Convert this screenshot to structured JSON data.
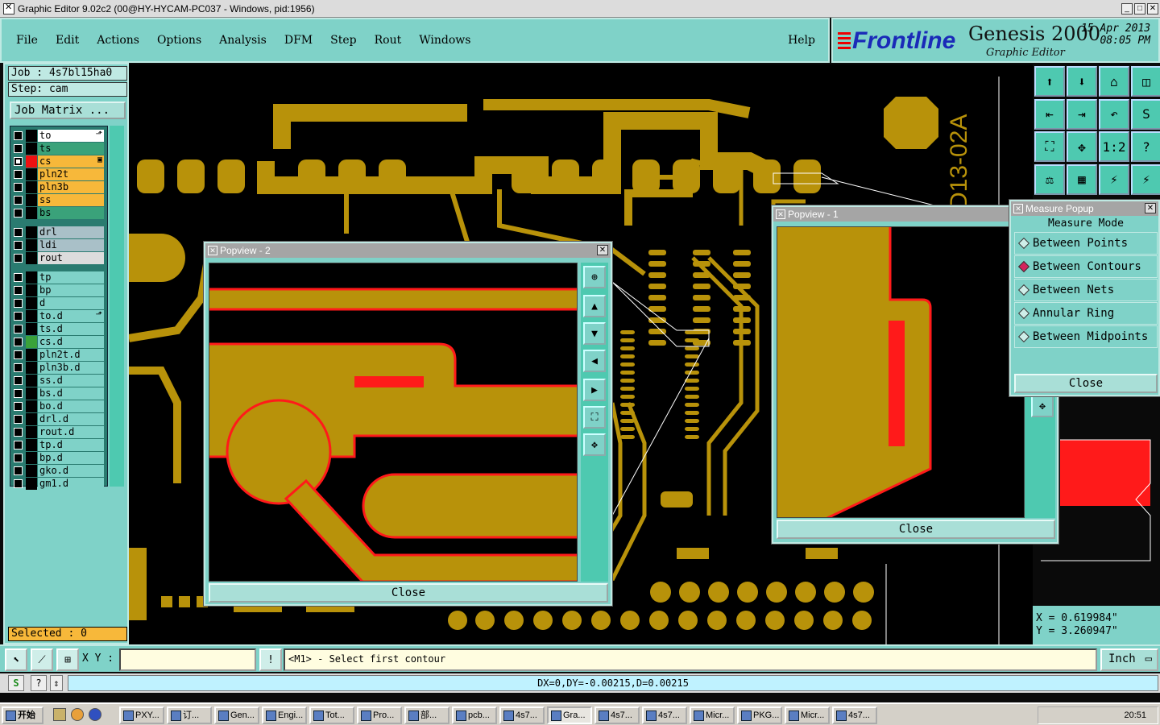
{
  "window": {
    "title": "Graphic Editor 9.02c2 (00@HY-HYCAM-PC037 - Windows, pid:1956)"
  },
  "menu": [
    "File",
    "Edit",
    "Actions",
    "Options",
    "Analysis",
    "DFM",
    "Step",
    "Rout",
    "Windows"
  ],
  "help": "Help",
  "brand": {
    "logo": "Frontline",
    "product": "Genesis 2000",
    "subtitle": "Graphic Editor",
    "date": "15 Apr 2013",
    "time": "08:05 PM"
  },
  "job": {
    "job": "Job  : 4s7bl15ha0",
    "step": "Step: cam",
    "matrix_button": "Job Matrix ..."
  },
  "layers": [
    {
      "name": "to",
      "bg": "#ffffff",
      "swatch": "#000000",
      "mark": "⬏",
      "checked": false
    },
    {
      "name": "ts",
      "bg": "#3aa27a",
      "swatch": "#000000",
      "mark": "",
      "checked": false
    },
    {
      "name": "cs",
      "bg": "#f7b83a",
      "swatch": "#ee1111",
      "mark": "▣",
      "checked": true
    },
    {
      "name": "pln2t",
      "bg": "#f7b83a",
      "swatch": "#000000",
      "mark": "",
      "checked": false
    },
    {
      "name": "pln3b",
      "bg": "#f7b83a",
      "swatch": "#000000",
      "mark": "",
      "checked": false
    },
    {
      "name": "ss",
      "bg": "#f7b83a",
      "swatch": "#000000",
      "mark": "",
      "checked": false
    },
    {
      "name": "bs",
      "bg": "#3aa27a",
      "swatch": "#000000",
      "mark": "",
      "checked": false
    },
    {
      "name": "drl",
      "bg": "#a9c0c8",
      "swatch": "#000000",
      "mark": "",
      "checked": false,
      "gap": true
    },
    {
      "name": "ldi",
      "bg": "#a9c0c8",
      "swatch": "#000000",
      "mark": "",
      "checked": false
    },
    {
      "name": "rout",
      "bg": "#dcdcdc",
      "swatch": "#000000",
      "mark": "",
      "checked": false
    },
    {
      "name": "tp",
      "bg": "#7fd2c8",
      "swatch": "#000000",
      "mark": "",
      "checked": false,
      "gap": true
    },
    {
      "name": "bp",
      "bg": "#7fd2c8",
      "swatch": "#000000",
      "mark": "",
      "checked": false
    },
    {
      "name": "d",
      "bg": "#7fd2c8",
      "swatch": "#000000",
      "mark": "",
      "checked": false
    },
    {
      "name": "to.d",
      "bg": "#7fd2c8",
      "swatch": "#000000",
      "mark": "⬏",
      "checked": false
    },
    {
      "name": "ts.d",
      "bg": "#7fd2c8",
      "swatch": "#000000",
      "mark": "",
      "checked": false
    },
    {
      "name": "cs.d",
      "bg": "#7fd2c8",
      "swatch": "#3aa23a",
      "mark": "",
      "checked": false
    },
    {
      "name": "pln2t.d",
      "bg": "#7fd2c8",
      "swatch": "#000000",
      "mark": "",
      "checked": false
    },
    {
      "name": "pln3b.d",
      "bg": "#7fd2c8",
      "swatch": "#000000",
      "mark": "",
      "checked": false
    },
    {
      "name": "ss.d",
      "bg": "#7fd2c8",
      "swatch": "#000000",
      "mark": "",
      "checked": false
    },
    {
      "name": "bs.d",
      "bg": "#7fd2c8",
      "swatch": "#000000",
      "mark": "",
      "checked": false
    },
    {
      "name": "bo.d",
      "bg": "#7fd2c8",
      "swatch": "#000000",
      "mark": "",
      "checked": false
    },
    {
      "name": "drl.d",
      "bg": "#7fd2c8",
      "swatch": "#000000",
      "mark": "",
      "checked": false
    },
    {
      "name": "rout.d",
      "bg": "#7fd2c8",
      "swatch": "#000000",
      "mark": "",
      "checked": false
    },
    {
      "name": "tp.d",
      "bg": "#7fd2c8",
      "swatch": "#000000",
      "mark": "",
      "checked": false
    },
    {
      "name": "bp.d",
      "bg": "#7fd2c8",
      "swatch": "#000000",
      "mark": "",
      "checked": false
    },
    {
      "name": "gko.d",
      "bg": "#7fd2c8",
      "swatch": "#000000",
      "mark": "",
      "checked": false
    },
    {
      "name": "gm1.d",
      "bg": "#7fd2c8",
      "swatch": "#000000",
      "mark": "",
      "checked": false
    }
  ],
  "selected": "Selected : 0",
  "board_label": "D13-02A",
  "colors": {
    "copper": "#b8920a",
    "highlight": "#ff1a1a",
    "panel": "#7fd2c8"
  },
  "popview2": {
    "title": "Popview - 2",
    "close": "Close"
  },
  "popview1": {
    "title": "Popview - 1",
    "close": "Close"
  },
  "measure": {
    "title": "Measure Popup",
    "mode_label": "Measure Mode",
    "options": [
      {
        "label": "Between Points",
        "selected": false
      },
      {
        "label": "Between Contours",
        "selected": true
      },
      {
        "label": "Between Nets",
        "selected": false
      },
      {
        "label": "Annular Ring",
        "selected": false
      },
      {
        "label": "Between Midpoints",
        "selected": false
      }
    ],
    "close": "Close"
  },
  "coords": {
    "x": "X = 0.619984\"",
    "y": "Y = 3.260947\""
  },
  "bottom": {
    "xy_label": "X Y :",
    "xy_value": "",
    "prompt": "<M1> - Select first contour",
    "unit": "Inch"
  },
  "status": "DX=0,DY=-0.00215,D=0.00215",
  "taskbar": {
    "start": "开始",
    "tasks": [
      "PXY...",
      "订...",
      "Gen...",
      "Engi...",
      "Tot...",
      "Pro...",
      "部...",
      "pcb...",
      "4s7...",
      "Gra...",
      "4s7...",
      "4s7...",
      "Micr...",
      "PKG...",
      "Micr...",
      "4s7..."
    ],
    "active_index": 9,
    "clock": "20:51"
  }
}
